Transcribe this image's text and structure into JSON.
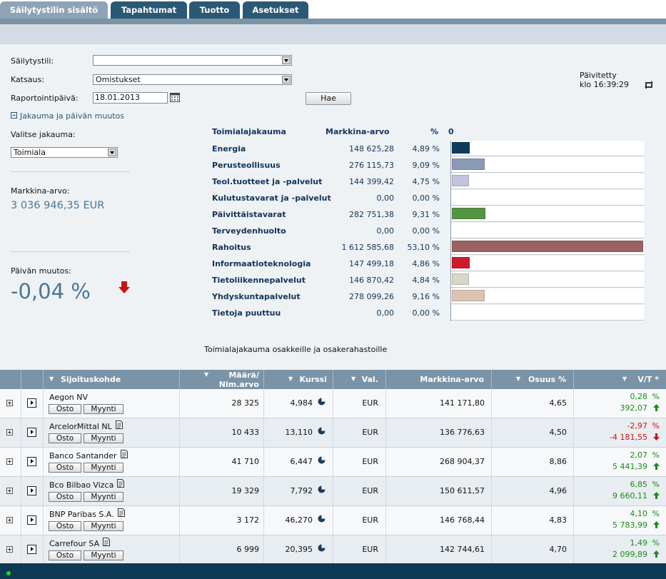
{
  "tabs": [
    {
      "label": "Säilytystilin sisältö",
      "active": true
    },
    {
      "label": "Tapahtumat",
      "active": false
    },
    {
      "label": "Tuotto",
      "active": false
    },
    {
      "label": "Asetukset",
      "active": false
    }
  ],
  "form": {
    "account_label": "Säilytystili:",
    "account_value": "",
    "view_label": "Katsaus:",
    "view_value": "Omistukset",
    "date_label": "Raportointipäivä:",
    "date_value": "18.01.2013",
    "search_button": "Hae",
    "updated_label": "Päivitetty",
    "updated_time": "klo 16:39:29"
  },
  "distribution_toggle": "Jakauma ja päivän muutos",
  "left": {
    "choose_label": "Valitse jakauma:",
    "choose_value": "Toimiala",
    "market_value_label": "Markkina-arvo:",
    "market_value": "3 036 946,35 EUR",
    "day_change_label": "Päivän muutos:",
    "day_change": "-0,04 %"
  },
  "distribution": {
    "headers": {
      "name": "Toimialajakauma",
      "value": "Markkina-arvo",
      "pct": "%",
      "zero": "0"
    },
    "rows": [
      {
        "name": "Energia",
        "value": "148 625,28",
        "pct": "4,89 %",
        "share": 4.89,
        "color": "#0e3c5c"
      },
      {
        "name": "Perusteollisuus",
        "value": "276 115,73",
        "pct": "9,09 %",
        "share": 9.09,
        "color": "#8a9ab5"
      },
      {
        "name": "Teol.tuotteet ja -palvelut",
        "value": "144 399,42",
        "pct": "4,75 %",
        "share": 4.75,
        "color": "#c1c4da"
      },
      {
        "name": "Kulutustavarat ja -palvelut",
        "value": "0,00",
        "pct": "0,00 %",
        "share": 0,
        "color": "#ffffff"
      },
      {
        "name": "Päivittäistavarat",
        "value": "282 751,38",
        "pct": "9,31 %",
        "share": 9.31,
        "color": "#559542"
      },
      {
        "name": "Terveydenhuolto",
        "value": "0,00",
        "pct": "0,00 %",
        "share": 0,
        "color": "#ffffff"
      },
      {
        "name": "Rahoitus",
        "value": "1 612 585,68",
        "pct": "53,10 %",
        "share": 53.1,
        "color": "#9a6262"
      },
      {
        "name": "Informaatioteknologia",
        "value": "147 499,18",
        "pct": "4,86 %",
        "share": 4.86,
        "color": "#cc1c2a"
      },
      {
        "name": "Tietoliikennepalvelut",
        "value": "146 870,42",
        "pct": "4,84 %",
        "share": 4.84,
        "color": "#d9d6c8"
      },
      {
        "name": "Yhdyskuntapalvelut",
        "value": "278 099,26",
        "pct": "9,16 %",
        "share": 9.16,
        "color": "#dcc4b0"
      },
      {
        "name": "Tietoja puuttuu",
        "value": "0,00",
        "pct": "0,00 %",
        "share": 0,
        "color": "#ffffff"
      }
    ],
    "caption": "Toimialajakauma osakkeille ja osakerahastoille"
  },
  "table": {
    "headers": {
      "name": "Sijoituskohde",
      "qty_line1": "Määrä/",
      "qty_line2": "Nim.arvo",
      "price": "Kurssi",
      "currency": "Val.",
      "market": "Markkina-arvo",
      "share": "Osuus %",
      "vt": "V/T *"
    },
    "buy_label": "Osto",
    "sell_label": "Myynti",
    "rows": [
      {
        "name": "Aegon NV",
        "doc": false,
        "qty": "28 325",
        "price": "4,984",
        "cur": "EUR",
        "market": "141 171,80",
        "share": "4,65",
        "vt_pct": "0,28",
        "vt_abs": "392,07",
        "dir": "up"
      },
      {
        "name": "ArcelorMittal NL",
        "doc": true,
        "qty": "10 433",
        "price": "13,110",
        "cur": "EUR",
        "market": "136 776,63",
        "share": "4,50",
        "vt_pct": "-2,97",
        "vt_abs": "-4 181,55",
        "dir": "down"
      },
      {
        "name": "Banco Santander",
        "doc": true,
        "qty": "41 710",
        "price": "6,447",
        "cur": "EUR",
        "market": "268 904,37",
        "share": "8,86",
        "vt_pct": "2,07",
        "vt_abs": "5 441,39",
        "dir": "up"
      },
      {
        "name": "Bco Bilbao Vizca",
        "doc": true,
        "qty": "19 329",
        "price": "7,792",
        "cur": "EUR",
        "market": "150 611,57",
        "share": "4,96",
        "vt_pct": "6,85",
        "vt_abs": "9 660,11",
        "dir": "up"
      },
      {
        "name": "BNP Paribas S.A.",
        "doc": true,
        "qty": "3 172",
        "price": "46,270",
        "cur": "EUR",
        "market": "146 768,44",
        "share": "4,83",
        "vt_pct": "4,10",
        "vt_abs": "5 783,99",
        "dir": "up"
      },
      {
        "name": "Carrefour SA",
        "doc": true,
        "qty": "6 999",
        "price": "20,395",
        "cur": "EUR",
        "market": "142 744,61",
        "share": "4,70",
        "vt_pct": "1,49",
        "vt_abs": "2 099,89",
        "dir": "up"
      }
    ]
  }
}
